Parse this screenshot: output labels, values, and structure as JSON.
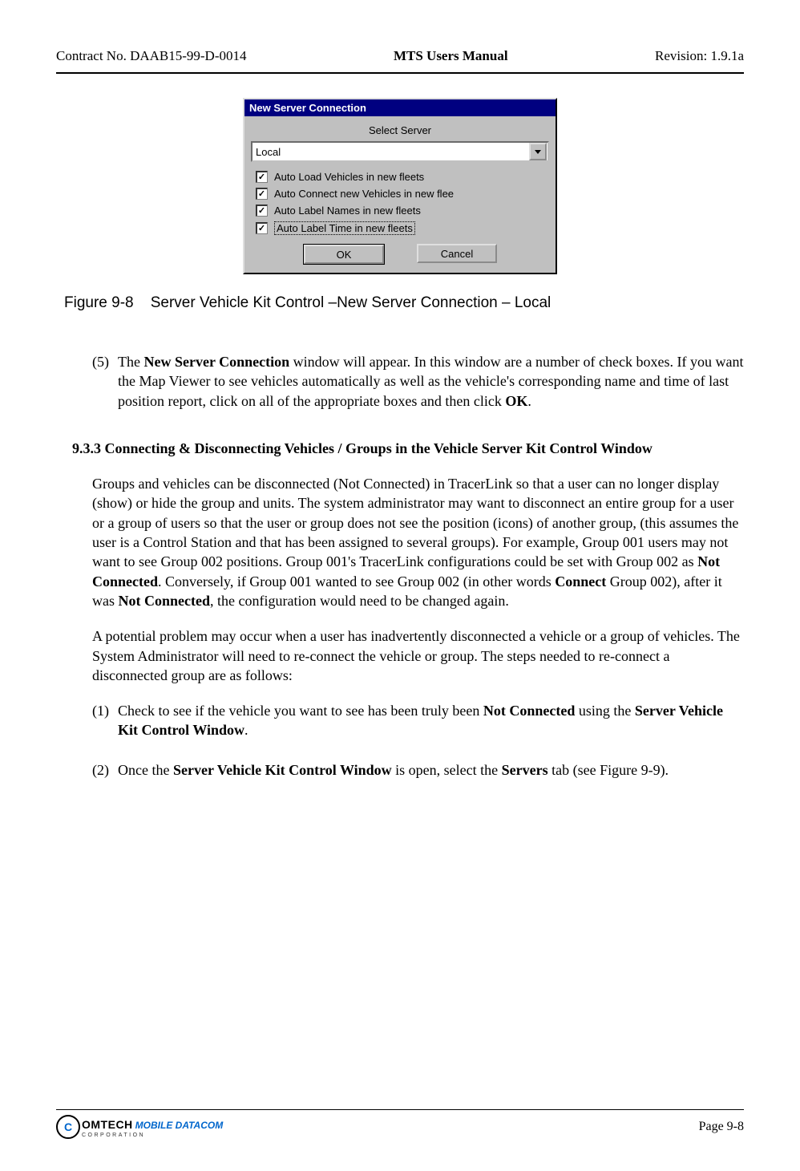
{
  "header": {
    "left": "Contract No. DAAB15-99-D-0014",
    "center": "MTS Users Manual",
    "right": "Revision:  1.9.1a"
  },
  "dialog": {
    "title": "New Server Connection",
    "select_label": "Select Server",
    "dropdown_value": "Local",
    "options": [
      "Auto Load Vehicles in new fleets",
      "Auto Connect new Vehicles in new flee",
      "Auto Label Names in new fleets",
      "Auto Label Time in new fleets"
    ],
    "ok": "OK",
    "cancel": "Cancel"
  },
  "figure_caption_prefix": "Figure 9-8",
  "figure_caption_text": "Server Vehicle Kit Control –New Server Connection – Local",
  "step5": {
    "num": "(5)",
    "t1": "The ",
    "b1": "New Server Connection",
    "t2": " window will appear.  In this window are a number of check boxes.  If you want the Map Viewer to see vehicles automatically as well as the vehicle's corresponding name and time of last position report, click on all of the appropriate boxes and then click ",
    "b2": "OK",
    "t3": "."
  },
  "section_heading": "9.3.3  Connecting & Disconnecting Vehicles / Groups in the Vehicle Server Kit Control Window",
  "para1": {
    "t1": "Groups and vehicles can be disconnected (Not Connected) in TracerLink so that a user can no longer display (show) or hide the group and units.  The system administrator may want to disconnect an entire group for a user or a group of users so that the user or group does not see the position (icons) of another group, (this assumes the user is a Control Station and that has been assigned to several groups).  For example, Group 001 users may not want to see Group 002 positions.  Group 001's TracerLink configurations could be set with Group 002 as ",
    "b1": "Not Connected",
    "t2": ".  Conversely, if Group 001 wanted to see Group 002 (in other words ",
    "b2": "Connect",
    "t3": " Group 002), after it was ",
    "b3": "Not Connected",
    "t4": ", the configuration would need to be changed again."
  },
  "para2": "A potential problem may occur when a user has inadvertently disconnected a vehicle or a group of vehicles.  The System Administrator will need to re-connect the vehicle or group.  The steps needed to re-connect a disconnected group are as follows:",
  "step1": {
    "num": "(1)",
    "t1": "Check to see if the vehicle you want to see has been truly been ",
    "b1": "Not Connected",
    "t2": " using the ",
    "b2": "Server Vehicle Kit Control Window",
    "t3": "."
  },
  "step2": {
    "num": "(2)",
    "t1": "Once the ",
    "b1": "Server Vehicle Kit Control Window",
    "t2": " is open, select the ",
    "b2": "Servers",
    "t3": " tab (see Figure 9-9)."
  },
  "footer": {
    "logo_main": "OMTECH",
    "logo_sub": "CORPORATION",
    "logo_mdc": "MOBILE DATACOM",
    "page": "Page 9-8"
  }
}
